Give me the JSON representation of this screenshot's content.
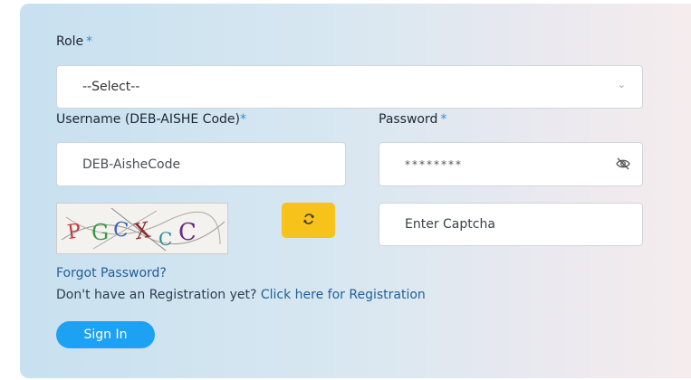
{
  "form": {
    "role_label": "Role",
    "required_mark": "*",
    "role_select_value": "--Select--",
    "username_label": "Username (DEB-AISHE Code)",
    "username_placeholder": "DEB-AisheCode",
    "password_label": "Password",
    "password_value": "********",
    "captcha_text": "PGCXCC",
    "captcha_placeholder": "Enter Captcha",
    "forgot_password": "Forgot Password?",
    "registration_prompt": "Don't have an Registration yet? ",
    "registration_link": "Click here for Registration",
    "sign_in": "Sign In"
  },
  "icons": {
    "select_chevron": "chevron-down-icon",
    "password_toggle": "eye-off-icon",
    "captcha_refresh": "refresh-icon"
  },
  "colors": {
    "accent": "#1da1f2",
    "refresh_button": "#f7c21a",
    "required": "#2f8fd8",
    "link": "#1f5f99"
  }
}
